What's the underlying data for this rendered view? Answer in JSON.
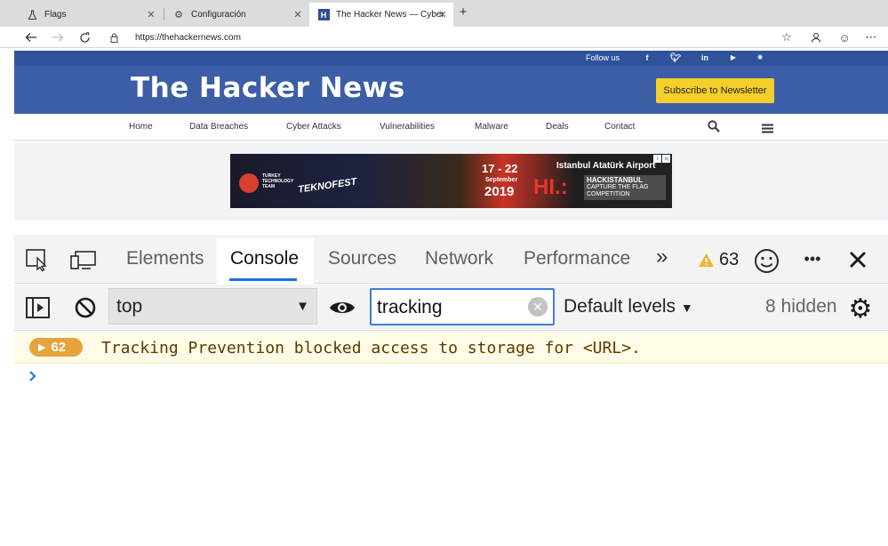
{
  "browser": {
    "tabs": [
      {
        "title": "Flags",
        "icon": "flask-icon",
        "active": false
      },
      {
        "title": "Configuración",
        "icon": "gear-icon",
        "active": false
      },
      {
        "title": "The Hacker News — Cyber Secu",
        "icon": "h-favicon",
        "active": true
      }
    ],
    "new_tab_glyph": "+",
    "url": "https://thehackernews.com"
  },
  "site": {
    "follow_label": "Follow us",
    "social": [
      "f",
      "t",
      "in",
      "▶",
      "rss"
    ],
    "logo": "The Hacker News",
    "subscribe_label": "Subscribe to Newsletter",
    "nav": [
      "Home",
      "Data Breaches",
      "Cyber Attacks",
      "Vulnerabilities",
      "Malware",
      "Deals",
      "Contact"
    ],
    "ad": {
      "team_line1": "TURKEY",
      "team_line2": "TECHNOLOGY",
      "team_line3": "TEAM",
      "teknofest": "TEKNOFEST",
      "dates": "17 - 22",
      "month": "September",
      "year": "2019",
      "venue": "Istanbul Atatürk Airport",
      "hack_mark": "HI.:",
      "hack_title": "HACKISTANBUL",
      "hack_sub1": "CAPTURE THE FLAG",
      "hack_sub2": "COMPETITION"
    }
  },
  "devtools": {
    "tabs": [
      "Elements",
      "Console",
      "Sources",
      "Network",
      "Performance"
    ],
    "more_glyph": "»",
    "warning_count": "63",
    "context": "top",
    "filter_value": "tracking",
    "levels_label": "Default levels",
    "hidden_label": "8 hidden",
    "message": {
      "count": "62",
      "text": "Tracking Prevention blocked access to storage for <URL>."
    },
    "prompt_glyph": ">"
  },
  "colors": {
    "site_blue": "#3c5ea6",
    "subscribe_yellow": "#f4cf2a",
    "active_underline": "#1a73e8",
    "badge_orange": "#e8a23b",
    "warning_bg": "#fffbe6"
  }
}
